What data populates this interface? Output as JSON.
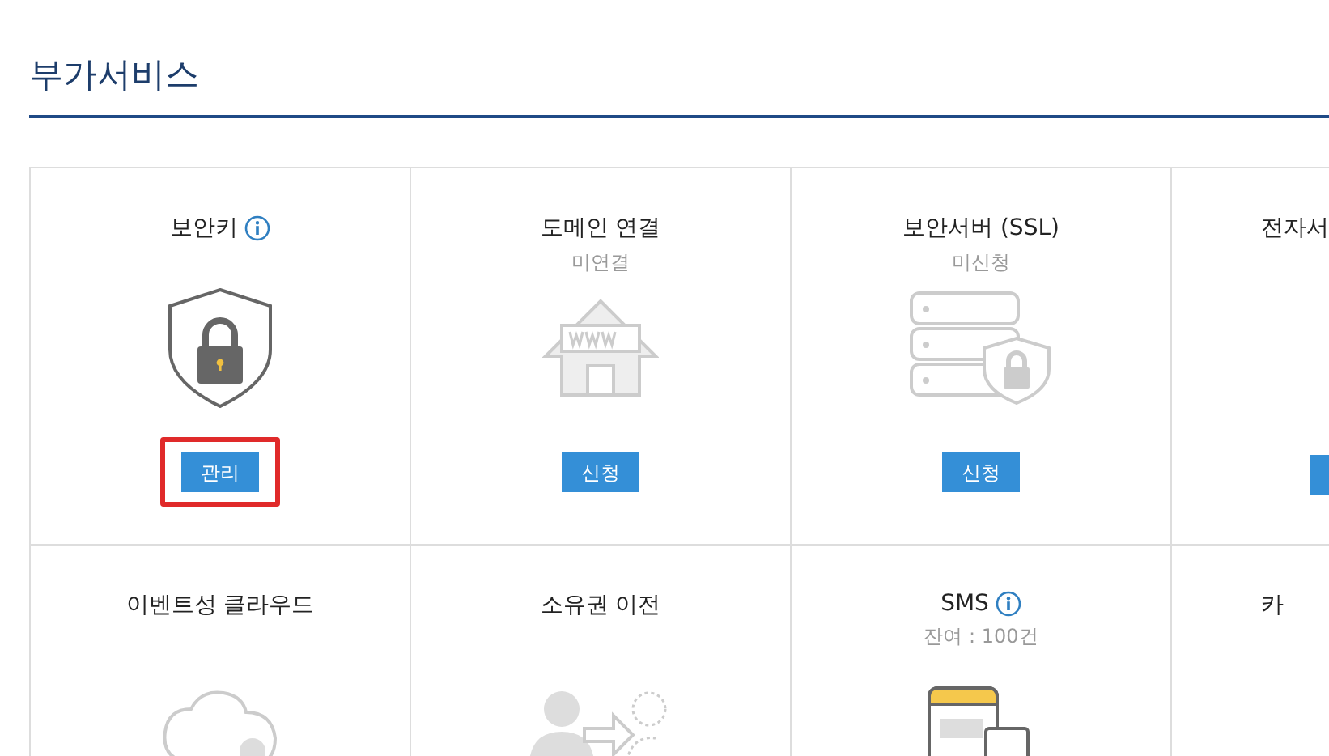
{
  "title": "부가서비스",
  "services": [
    {
      "kind": "security-key",
      "title": "보안키",
      "info": true,
      "button": {
        "label": "관리",
        "highlighted": true
      }
    },
    {
      "kind": "domain",
      "title": "도메인 연결",
      "subtitle": "미연결",
      "button": {
        "label": "신청",
        "highlighted": false
      }
    },
    {
      "kind": "ssl",
      "title": "보안서버 (SSL)",
      "subtitle": "미신청",
      "button": {
        "label": "신청",
        "highlighted": false
      }
    },
    {
      "kind": "cut-off-button",
      "title": "전자서"
    },
    {
      "kind": "cloud",
      "title": "이벤트성 클라우드"
    },
    {
      "kind": "transfer",
      "title": "소유권 이전"
    },
    {
      "kind": "sms",
      "title": "SMS",
      "subtitle": "잔여 : 100건",
      "info": true
    },
    {
      "kind": "cut-off",
      "title": "카"
    }
  ]
}
